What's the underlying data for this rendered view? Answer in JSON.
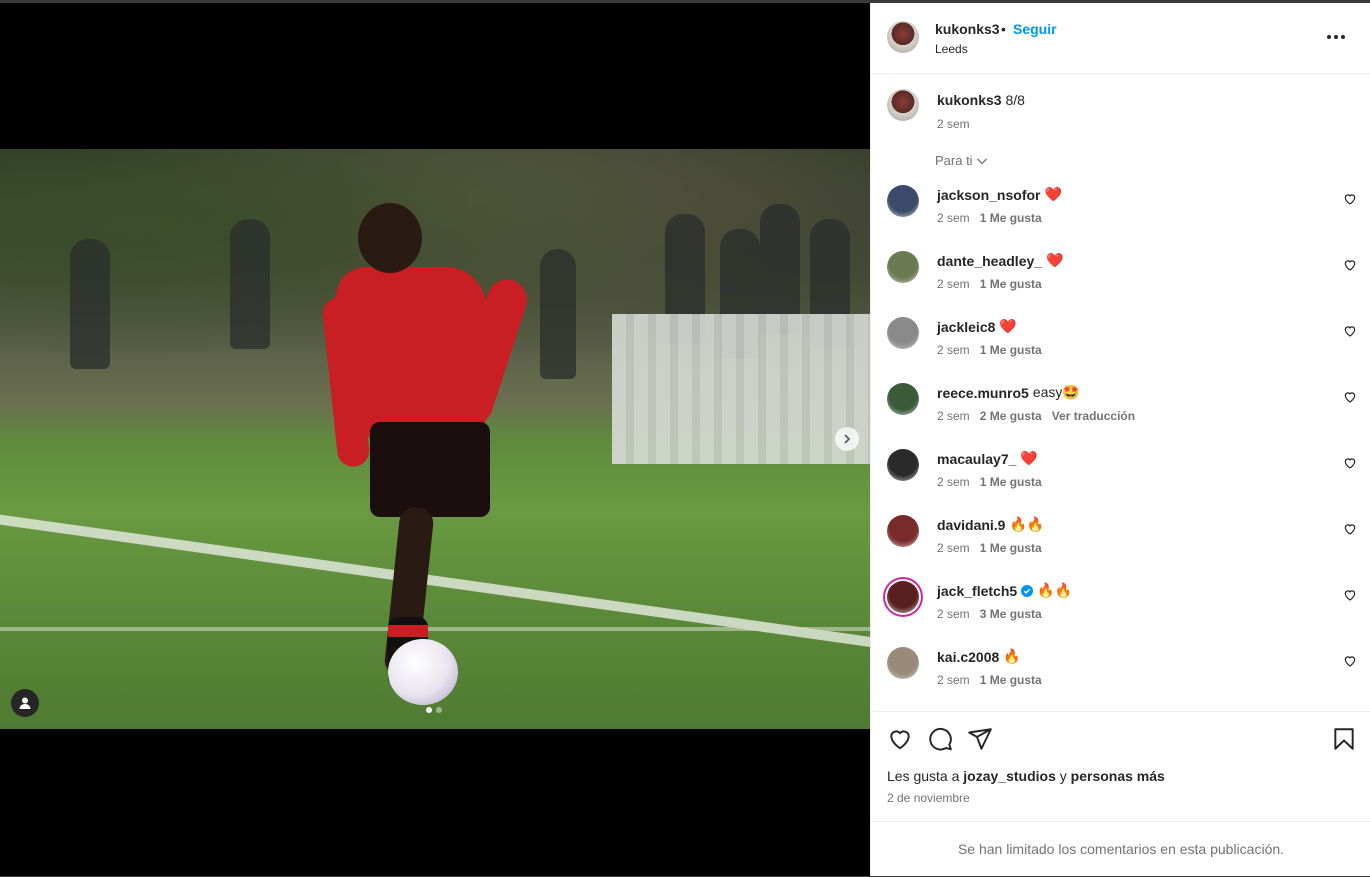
{
  "post": {
    "username": "kukonks3",
    "follow_label": "Seguir",
    "separator": "•",
    "location": "Leeds",
    "caption_text": "8/8",
    "caption_time": "2 sem",
    "filter_label": "Para ti",
    "carousel": {
      "current": 1,
      "total": 2
    }
  },
  "comments": [
    {
      "user": "jackson_nsofor",
      "text": "❤️",
      "time": "2 sem",
      "likes": "1 Me gusta",
      "extra": "",
      "avatar_color": "#3b4a6b"
    },
    {
      "user": "dante_headley_",
      "text": "❤️",
      "time": "2 sem",
      "likes": "1 Me gusta",
      "extra": "",
      "avatar_color": "#6b7a52"
    },
    {
      "user": "jackleic8",
      "text": "❤️",
      "time": "2 sem",
      "likes": "1 Me gusta",
      "extra": "",
      "avatar_color": "#8a8a8a"
    },
    {
      "user": "reece.munro5",
      "text": "easy🤩",
      "time": "2 sem",
      "likes": "2 Me gusta",
      "extra": "Ver traducción",
      "avatar_color": "#3a5a3a"
    },
    {
      "user": "macaulay7_",
      "text": "❤️",
      "time": "2 sem",
      "likes": "1 Me gusta",
      "extra": "",
      "avatar_color": "#2a2a2a"
    },
    {
      "user": "davidani.9",
      "text": "🔥🔥",
      "time": "2 sem",
      "likes": "1 Me gusta",
      "extra": "",
      "avatar_color": "#7a2a2a"
    },
    {
      "user": "jack_fletch5",
      "text": "🔥🔥",
      "time": "2 sem",
      "likes": "3 Me gusta",
      "extra": "",
      "avatar_color": "#5a2020",
      "verified": true
    },
    {
      "user": "kai.c2008",
      "text": "🔥",
      "time": "2 sem",
      "likes": "1 Me gusta",
      "extra": "",
      "avatar_color": "#9a8a7a"
    }
  ],
  "actions": {
    "likes_prefix": "Les gusta a",
    "likes_user": "jozay_studios",
    "likes_conj": "y",
    "likes_suffix": "personas más",
    "date": "2 de noviembre"
  },
  "footer": {
    "notice": "Se han limitado los comentarios en esta publicación."
  },
  "colors": {
    "accent": "#0095f6",
    "text": "#262626",
    "muted": "#737373",
    "like_red": "#ff3040"
  },
  "icons": [
    "more-icon",
    "chevron-down-icon",
    "heart-icon",
    "comment-icon",
    "share-icon",
    "bookmark-icon",
    "user-tag-icon",
    "chevron-right-icon",
    "verified-icon"
  ]
}
